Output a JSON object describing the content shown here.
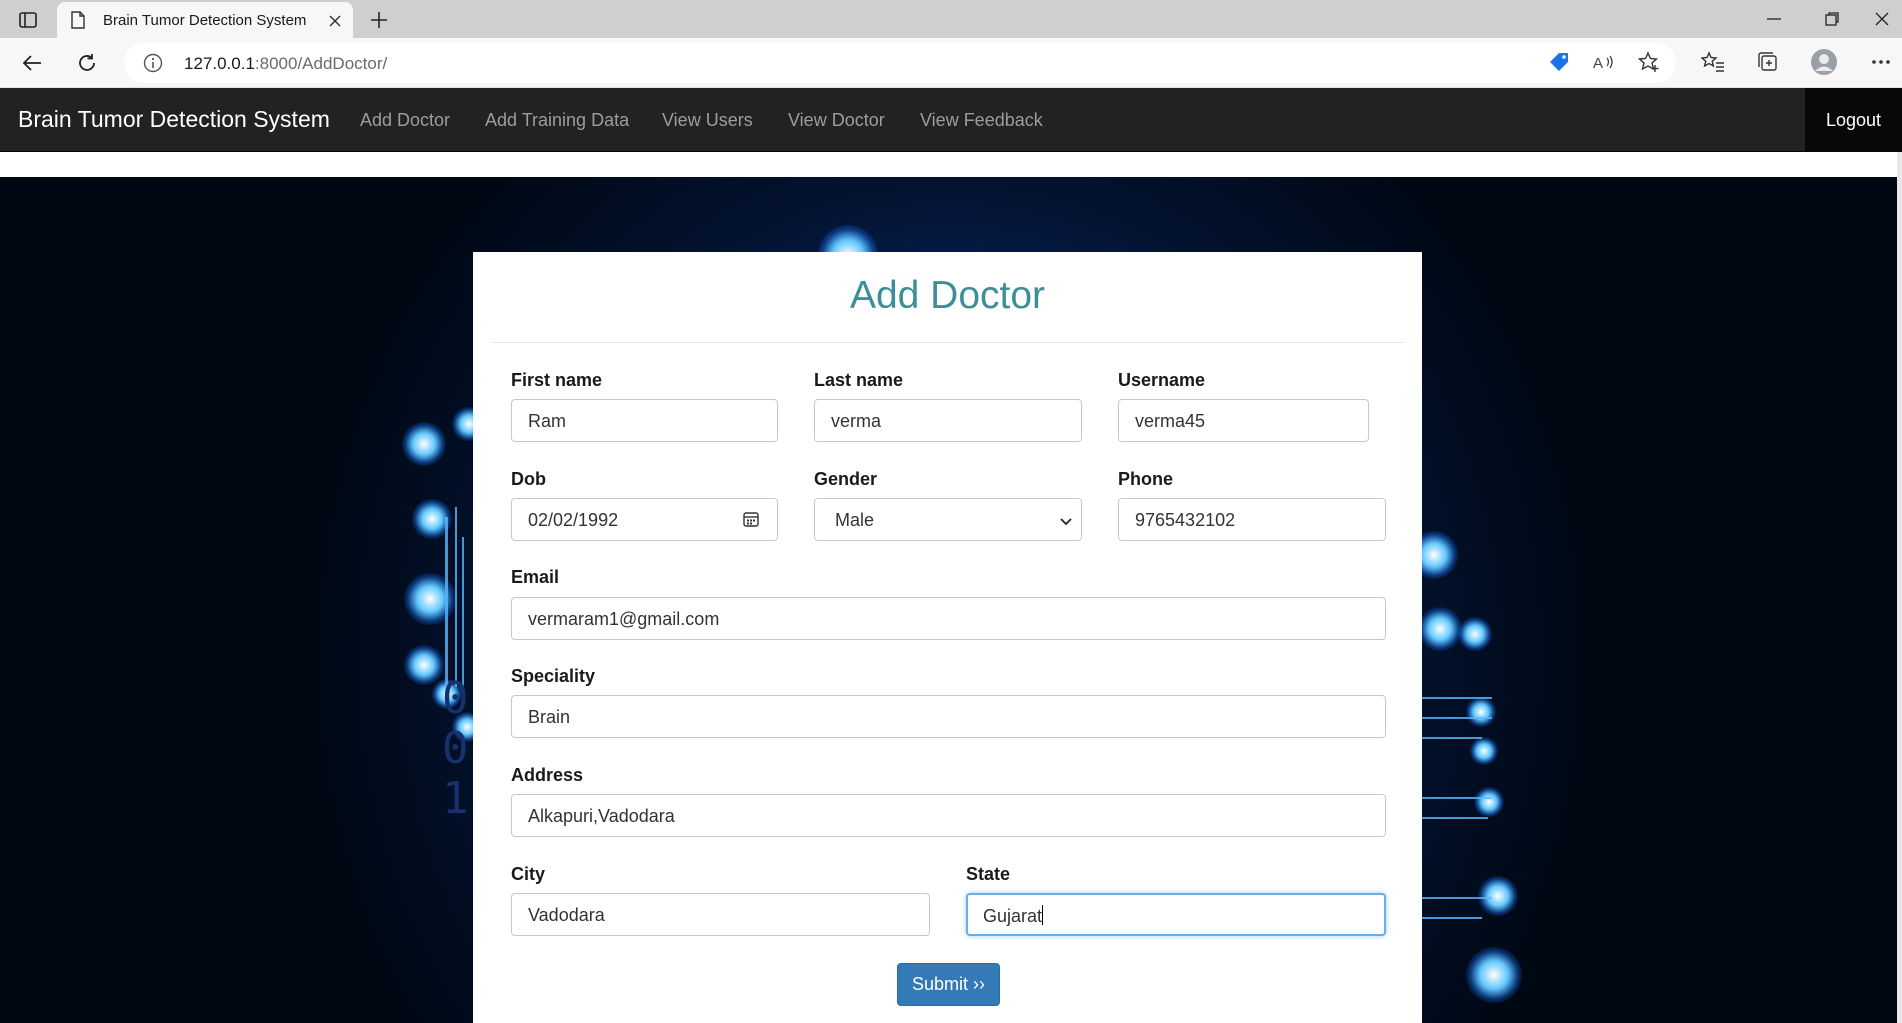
{
  "browser": {
    "tab_title": "Brain Tumor Detection System",
    "url_host": "127.0.0.1",
    "url_path": ":8000/AddDoctor/"
  },
  "navbar": {
    "brand": "Brain Tumor Detection System",
    "links": [
      "Add Doctor",
      "Add Training Data",
      "View Users",
      "View Doctor",
      "View Feedback"
    ],
    "logout": "Logout"
  },
  "background": {
    "binary_digits": [
      "0",
      "0",
      "1"
    ]
  },
  "form": {
    "title": "Add Doctor",
    "fields": {
      "first_name": {
        "label": "First name",
        "value": "Ram"
      },
      "last_name": {
        "label": "Last name",
        "value": "verma"
      },
      "username": {
        "label": "Username",
        "value": "verma45"
      },
      "dob": {
        "label": "Dob",
        "value": "02/02/1992"
      },
      "gender": {
        "label": "Gender",
        "value": "Male"
      },
      "phone": {
        "label": "Phone",
        "value": "9765432102"
      },
      "email": {
        "label": "Email",
        "value": "vermaram1@gmail.com"
      },
      "speciality": {
        "label": "Speciality",
        "value": "Brain"
      },
      "address": {
        "label": "Address",
        "value": "Alkapuri,Vadodara"
      },
      "city": {
        "label": "City",
        "value": "Vadodara"
      },
      "state": {
        "label": "State",
        "value": "Gujarat"
      }
    },
    "submit_label": "Submit ››"
  },
  "colors": {
    "navbar_bg": "#222222",
    "title_color": "#3c8f96",
    "submit_bg": "#337ab7",
    "focus_border": "#66afe9"
  }
}
